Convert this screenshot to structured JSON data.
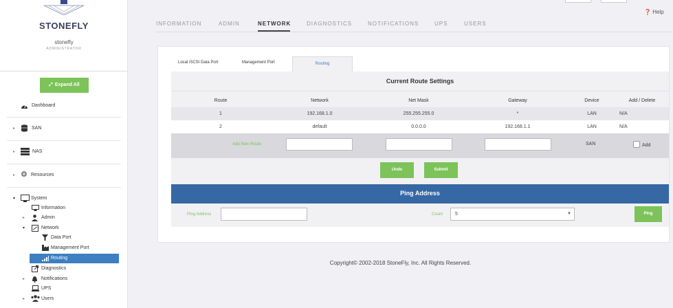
{
  "brand": {
    "name": "STONEFLY"
  },
  "user": {
    "name": "stonefly",
    "role": "ADMINISTRATOR"
  },
  "sidebar": {
    "expand_all": "Expand All",
    "items": [
      {
        "label": "Dashboard"
      },
      {
        "label": "SAN"
      },
      {
        "label": "NAS"
      },
      {
        "label": "Resources"
      },
      {
        "label": "System"
      }
    ],
    "system_children": [
      {
        "label": "Information"
      },
      {
        "label": "Admin"
      },
      {
        "label": "Network"
      },
      {
        "label": "Data Port"
      },
      {
        "label": "Management Port"
      },
      {
        "label": "Routing"
      },
      {
        "label": "Diagnostics"
      },
      {
        "label": "Notifications"
      },
      {
        "label": "UPS"
      },
      {
        "label": "Users"
      }
    ]
  },
  "top_tabs": [
    {
      "label": "INFORMATION"
    },
    {
      "label": "ADMIN"
    },
    {
      "label": "NETWORK",
      "active": true
    },
    {
      "label": "DIAGNOSTICS"
    },
    {
      "label": "NOTIFICATIONS"
    },
    {
      "label": "UPS"
    },
    {
      "label": "USERS"
    }
  ],
  "help": "Help",
  "sub_tabs": [
    {
      "label": "Local iSCSI Data Port"
    },
    {
      "label": "Management Port"
    },
    {
      "label": "Routing",
      "active": true
    }
  ],
  "route_settings": {
    "title": "Current Route Settings",
    "columns": [
      "Route",
      "Network",
      "Net Mask",
      "Gateway",
      "Device",
      "Add / Delete"
    ],
    "rows": [
      {
        "route": "1",
        "network": "192.168.1.0",
        "netmask": "255.255.255.0",
        "gateway": "*",
        "device": "LAN",
        "action": "N/A"
      },
      {
        "route": "2",
        "network": "default",
        "netmask": "0.0.0.0",
        "gateway": "192.168.1.1",
        "device": "LAN",
        "action": "N/A"
      }
    ],
    "add_row": {
      "label": "Add New Route",
      "network_value": "",
      "netmask_value": "",
      "gateway_value": "",
      "device": "SAN",
      "checkbox_label": "Add"
    },
    "undo": "Undo",
    "submit": "Submit"
  },
  "ping": {
    "title": "Ping Address",
    "address_label": "Ping Address",
    "address_value": "",
    "count_label": "Count",
    "count_value": "5",
    "button": "Ping"
  },
  "footer": {
    "copyright": "Copyright© 2002-2018 StoneFly, Inc. All Rights Reserved."
  },
  "colors": {
    "accent_green": "#7cc35a",
    "accent_blue": "#3568a4",
    "active_nav": "#3d7fc1"
  }
}
